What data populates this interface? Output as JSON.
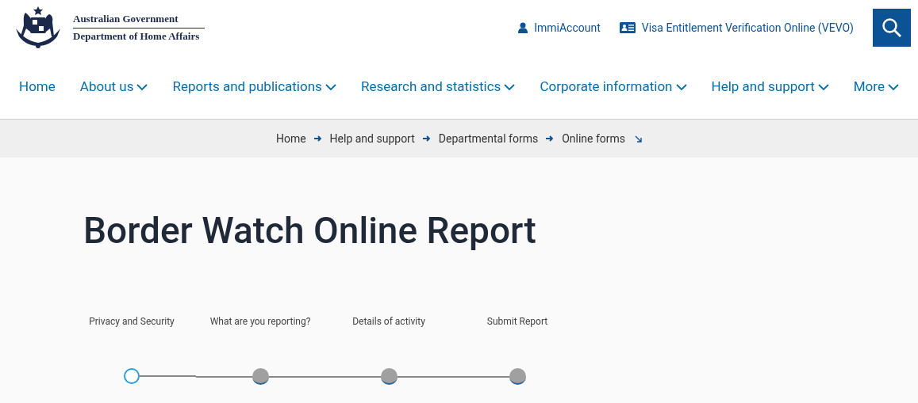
{
  "header": {
    "logo_lines": [
      "Australian Government",
      "Department of Home Affairs"
    ],
    "links": [
      {
        "kind": "person",
        "label": "ImmiAccount"
      },
      {
        "kind": "card",
        "label": "Visa Entitlement Verification Online (VEVO)"
      }
    ]
  },
  "nav": [
    {
      "label": "Home",
      "has_menu": false
    },
    {
      "label": "About us",
      "has_menu": true
    },
    {
      "label": "Reports and publications",
      "has_menu": true
    },
    {
      "label": "Research and statistics",
      "has_menu": true
    },
    {
      "label": "Corporate information",
      "has_menu": true
    },
    {
      "label": "Help and support",
      "has_menu": true
    },
    {
      "label": "More",
      "has_menu": true
    }
  ],
  "breadcrumb": [
    {
      "label": "Home",
      "kind": "link"
    },
    {
      "label": "Help and support",
      "kind": "link"
    },
    {
      "label": "Departmental forms",
      "kind": "link"
    },
    {
      "label": "Online forms",
      "kind": "current"
    }
  ],
  "title": "Border Watch Online Report",
  "steps": [
    {
      "label": "Privacy and Security",
      "selected": true
    },
    {
      "label": "What are you reporting?",
      "selected": false
    },
    {
      "label": "Details of activity",
      "selected": false
    },
    {
      "label": "Submit Report",
      "selected": false
    }
  ]
}
